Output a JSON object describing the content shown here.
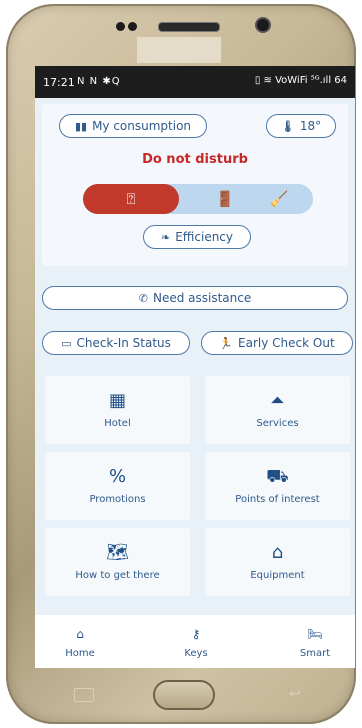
{
  "statusbar": {
    "time": "17:21",
    "left_icons": "N N ✱Q",
    "right_icons": "▯ ≋ VoWiFi ⁵ᴳ.ıll 64"
  },
  "panel": {
    "consumption_label": "My consumption",
    "temperature": "18°",
    "dnd_text": "Do not disturb",
    "efficiency_label": "Efficiency"
  },
  "actions": {
    "assistance_label": "Need assistance",
    "checkin_label": "Check-In Status",
    "checkout_label": "Early Check Out"
  },
  "tiles": [
    {
      "label": "Hotel",
      "icon": "hotel-icon",
      "glyph": "▦"
    },
    {
      "label": "Services",
      "icon": "bell-icon",
      "glyph": "⏶"
    },
    {
      "label": "Promotions",
      "icon": "percent-icon",
      "glyph": "%"
    },
    {
      "label": "Points of interest",
      "icon": "car-icon",
      "glyph": "⛟"
    },
    {
      "label": "How to get there",
      "icon": "map-icon",
      "glyph": "🗺"
    },
    {
      "label": "Equipment",
      "icon": "house-icon",
      "glyph": "⌂"
    }
  ],
  "nav": {
    "home_label": "Home",
    "keys_label": "Keys",
    "smart_label": "Smart"
  },
  "colors": {
    "accent": "#2f5a8c",
    "alert": "#c62828",
    "background": "#e8f0f8"
  }
}
